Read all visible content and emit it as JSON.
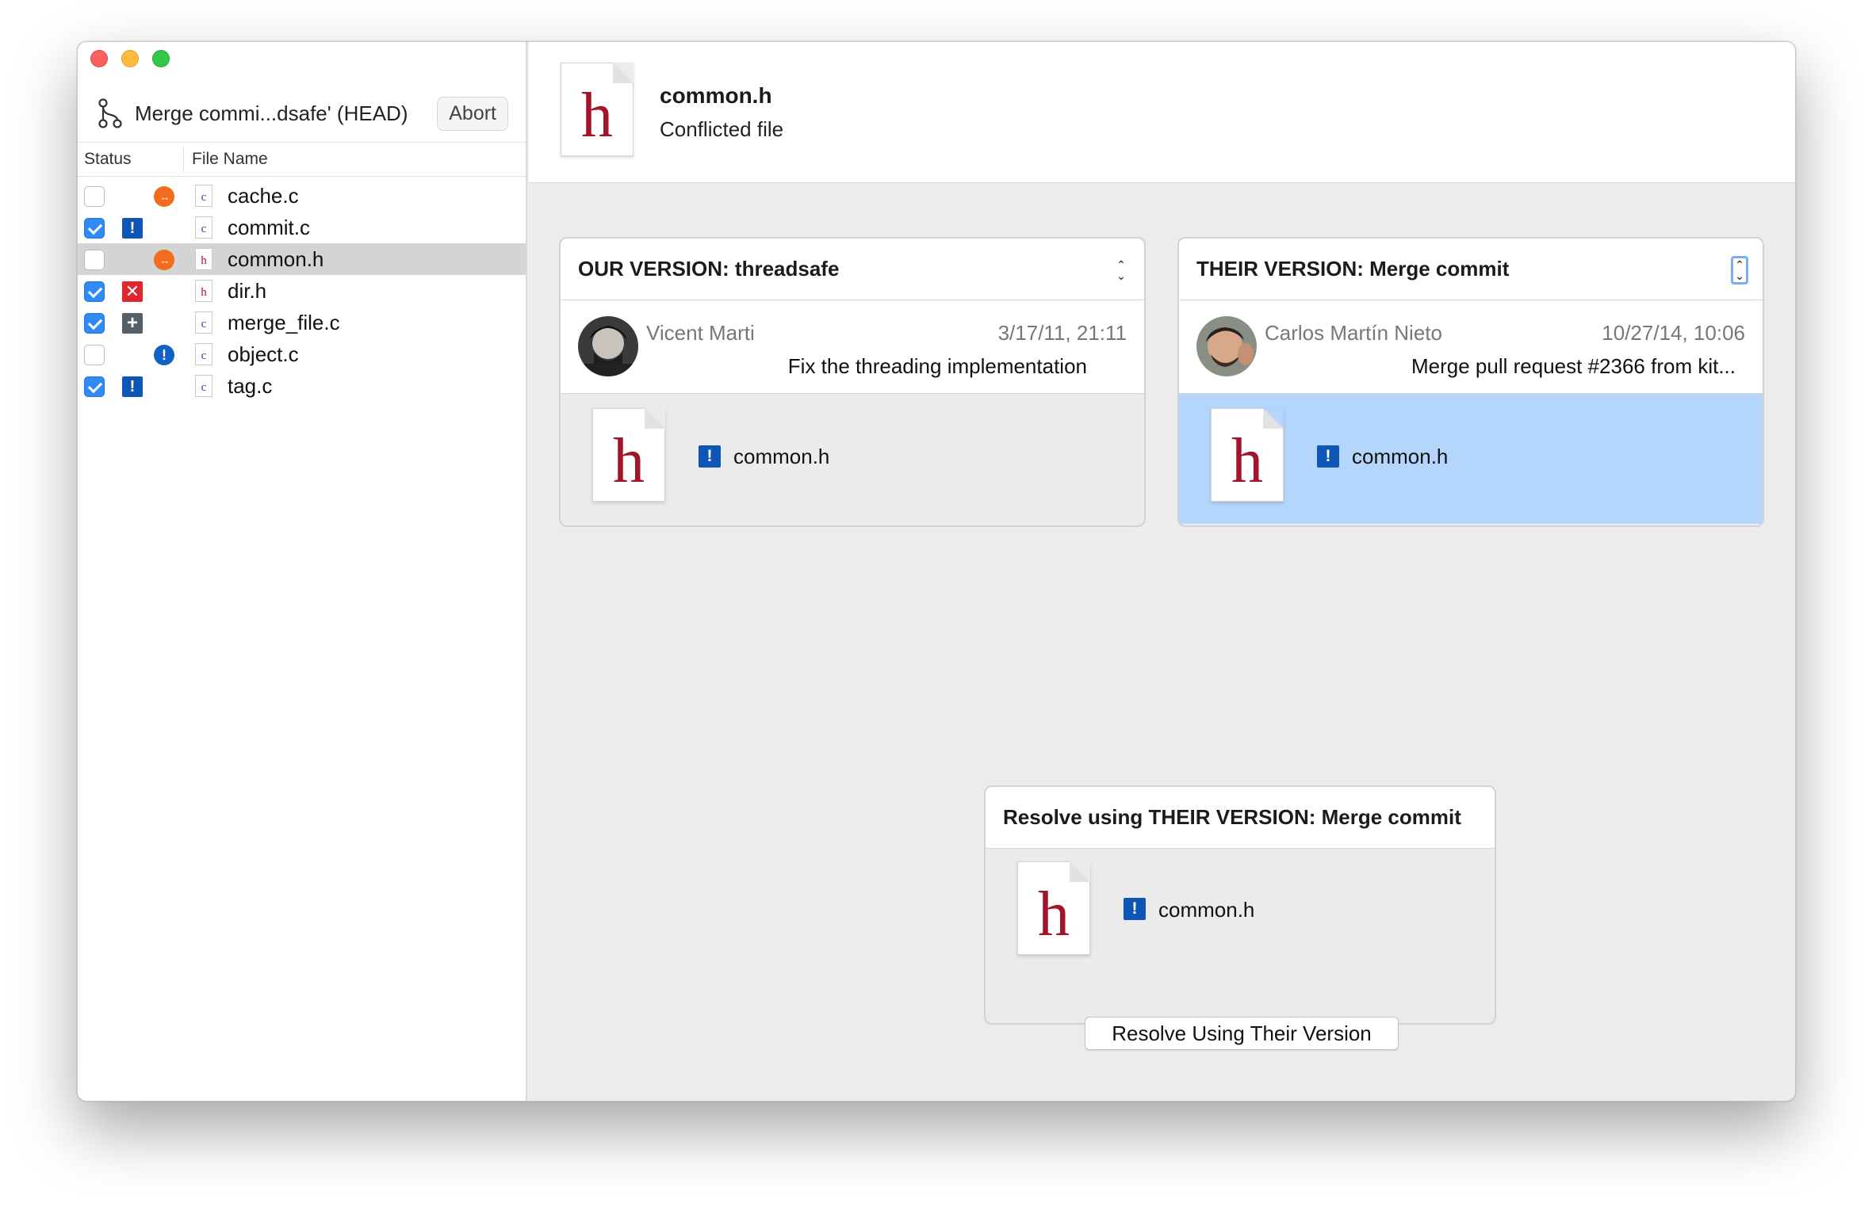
{
  "window": {
    "branch_label": "Merge commi...dsafe' (HEAD)",
    "abort_label": "Abort"
  },
  "file_list": {
    "headers": {
      "status": "Status",
      "file_name": "File Name"
    },
    "files": [
      {
        "name": "cache.c",
        "checked": false,
        "status": "conflict",
        "type": "c"
      },
      {
        "name": "commit.c",
        "checked": true,
        "status": "modified",
        "type": "c"
      },
      {
        "name": "common.h",
        "checked": false,
        "status": "conflict",
        "type": "h",
        "selected": true
      },
      {
        "name": "dir.h",
        "checked": true,
        "status": "deleted",
        "type": "h"
      },
      {
        "name": "merge_file.c",
        "checked": true,
        "status": "added",
        "type": "c"
      },
      {
        "name": "object.c",
        "checked": false,
        "status": "info",
        "type": "c"
      },
      {
        "name": "tag.c",
        "checked": true,
        "status": "modified",
        "type": "c"
      }
    ]
  },
  "header": {
    "doc_glyph": "h",
    "title": "common.h",
    "subtitle": "Conflicted file"
  },
  "our_version": {
    "title": "OUR VERSION: threadsafe",
    "author": "Vicent Marti",
    "date": "3/17/11, 21:11",
    "message": "Fix the threading implementation",
    "file_name": "common.h"
  },
  "their_version": {
    "title": "THEIR VERSION: Merge commit",
    "author": "Carlos Martín Nieto",
    "date": "10/27/14, 10:06",
    "message": "Merge pull request #2366 from kit...",
    "file_name": "common.h"
  },
  "resolution": {
    "title": "Resolve using THEIR VERSION: Merge commit",
    "file_name": "common.h",
    "button_label": "Resolve Using Their Version"
  },
  "icons": {
    "modified": "!",
    "deleted": "✕",
    "added": "+",
    "conflict": "↔",
    "info": "!"
  },
  "colors": {
    "accent": "#2f8bf5",
    "selection": "#b4d6fd",
    "header_doc_letter": "#a3142a",
    "conflict": "#f36b1c",
    "deleted": "#e0252c",
    "modified": "#0d56b7"
  }
}
